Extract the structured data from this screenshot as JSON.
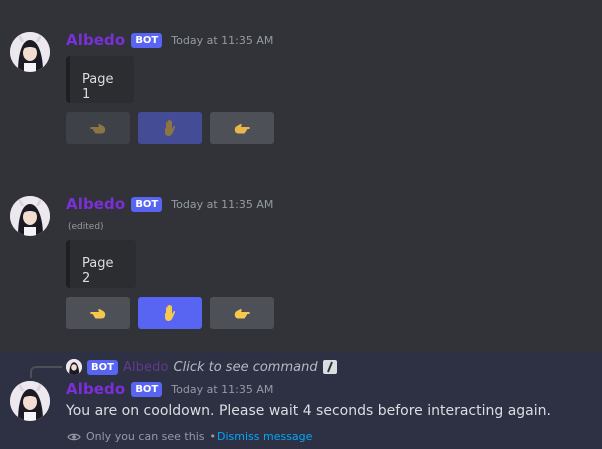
{
  "messages": [
    {
      "username": "Albedo",
      "bot_tag": "BOT",
      "timestamp": "Today at 11:35 AM",
      "embed_text": "Page 1",
      "buttons": [
        {
          "icon": "left-pointing-hand-icon",
          "variant": "secondary",
          "disabled": true
        },
        {
          "icon": "raised-hand-icon",
          "variant": "primary",
          "disabled": true
        },
        {
          "icon": "right-pointing-hand-icon",
          "variant": "secondary",
          "disabled": false
        }
      ]
    },
    {
      "username": "Albedo",
      "bot_tag": "BOT",
      "timestamp": "Today at 11:35 AM",
      "edited_label": "(edited)",
      "embed_text": "Page 2",
      "buttons": [
        {
          "icon": "left-pointing-hand-icon",
          "variant": "secondary",
          "disabled": false
        },
        {
          "icon": "raised-hand-icon",
          "variant": "primary",
          "disabled": false
        },
        {
          "icon": "right-pointing-hand-icon",
          "variant": "secondary",
          "disabled": false
        }
      ]
    }
  ],
  "ephemeral": {
    "reply": {
      "bot_tag": "BOT",
      "username": "Albedo",
      "command_text": "Click to see command"
    },
    "username": "Albedo",
    "bot_tag": "BOT",
    "timestamp": "Today at 11:35 AM",
    "text": "You are on cooldown. Please wait 4 seconds before interacting again.",
    "only_you_text": "Only you can see this",
    "separator": "•",
    "dismiss_label": "Dismiss message"
  },
  "colors": {
    "background": "#313338",
    "username": "#7b2fd8",
    "blurple": "#5865f2",
    "secondary_button": "#4e5058",
    "link": "#00a8fc",
    "ephemeral_highlight": "#2e3044"
  }
}
